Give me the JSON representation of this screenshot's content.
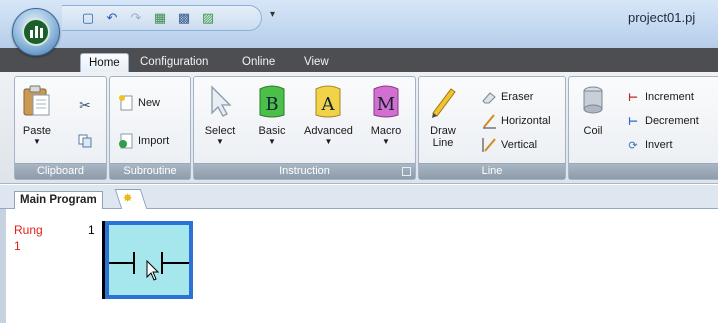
{
  "window": {
    "title": "project01.pj"
  },
  "tabs": [
    {
      "label": "Home"
    },
    {
      "label": "Configuration"
    },
    {
      "label": "Online"
    },
    {
      "label": "View"
    }
  ],
  "ribbon": {
    "clipboard": {
      "label": "Clipboard",
      "paste": "Paste"
    },
    "subroutine": {
      "label": "Subroutine",
      "new": "New",
      "import": "Import"
    },
    "instruction": {
      "label": "Instruction",
      "select": "Select",
      "basic": "Basic",
      "advanced": "Advanced",
      "macro": "Macro",
      "basic_glyph": "B",
      "advanced_glyph": "A",
      "macro_glyph": "M"
    },
    "line": {
      "label": "Line",
      "draw_line_1": "Draw",
      "draw_line_2": "Line",
      "eraser": "Eraser",
      "horizontal": "Horizontal",
      "vertical": "Vertical"
    },
    "coil_group": {
      "coil": "Coil",
      "increment": "Increment",
      "decrement": "Decrement",
      "invert": "Invert"
    }
  },
  "document": {
    "tab": "Main Program"
  },
  "ladder": {
    "rung_word": "Rung",
    "rung_index": "1",
    "rung_number": "1"
  },
  "colors": {
    "tab_bar": "#4c4e52",
    "rung_text": "#e0201a",
    "cell_fill": "#a6e7ee",
    "cell_border": "#2b72d6"
  }
}
